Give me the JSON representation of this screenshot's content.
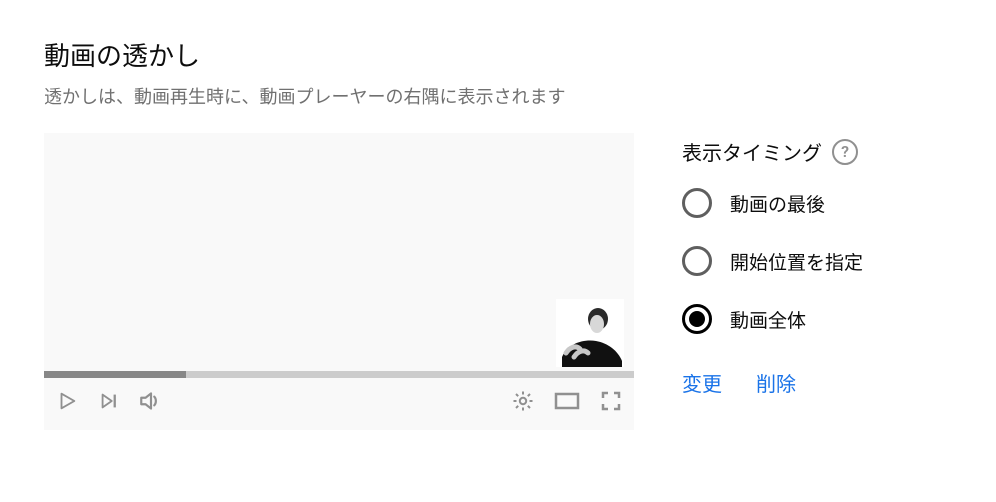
{
  "header": {
    "title": "動画の透かし",
    "subtitle": "透かしは、動画再生時に、動画プレーヤーの右隅に表示されます"
  },
  "preview": {
    "progress_percent": 24,
    "icons": {
      "play": "play-icon",
      "next": "next-icon",
      "volume": "volume-icon",
      "settings": "gear-icon",
      "theater": "theater-icon",
      "fullscreen": "fullscreen-icon"
    }
  },
  "sidepanel": {
    "title": "表示タイミング",
    "help_glyph": "?",
    "options": [
      {
        "label": "動画の最後",
        "selected": false
      },
      {
        "label": "開始位置を指定",
        "selected": false
      },
      {
        "label": "動画全体",
        "selected": true
      }
    ],
    "actions": {
      "change": "変更",
      "remove": "削除"
    }
  }
}
